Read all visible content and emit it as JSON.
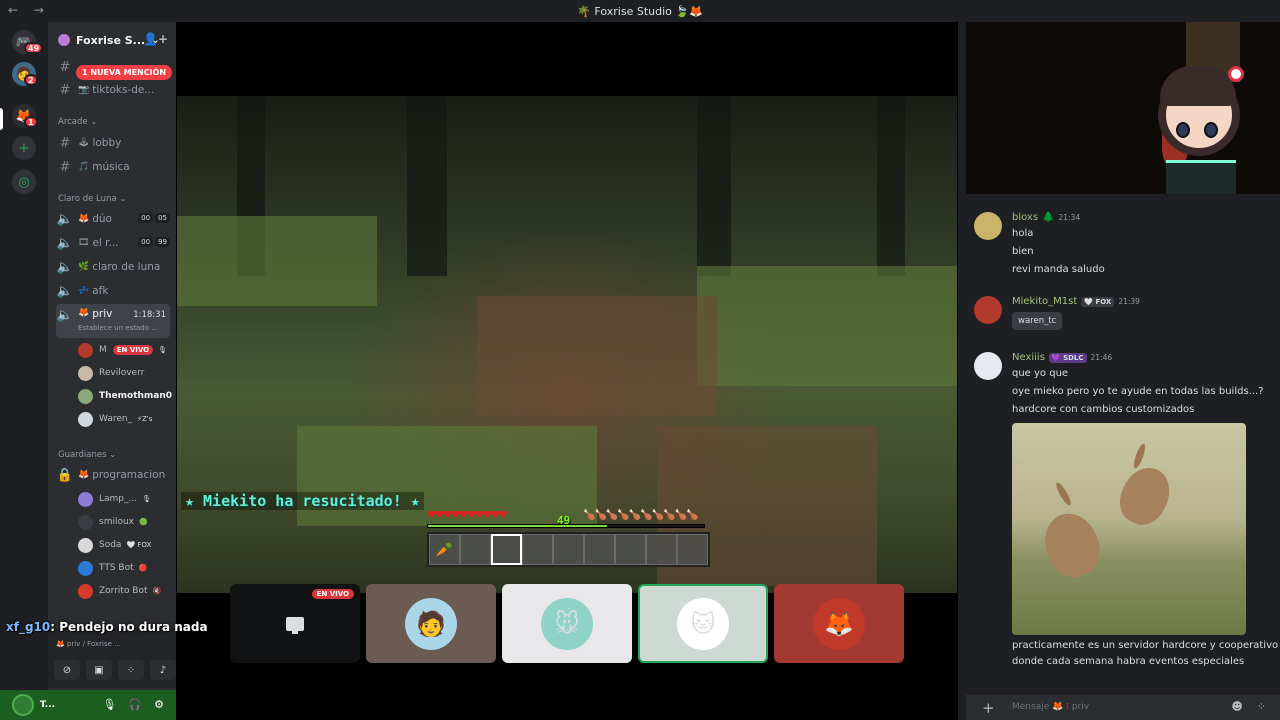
{
  "window": {
    "title": "🌴 Foxrise Studio 🍃🦊",
    "nav": "← →"
  },
  "rail": {
    "items": [
      {
        "name": "discord-home",
        "glyph": "🎮",
        "badge": "49"
      },
      {
        "name": "server-avatar",
        "glyph": "🧑",
        "badge": "2"
      },
      {
        "name": "foxrise-server",
        "glyph": "🦊",
        "badge": "1"
      },
      {
        "name": "add-server",
        "glyph": "+",
        "badge": ""
      },
      {
        "name": "discover",
        "glyph": "◎",
        "badge": ""
      }
    ]
  },
  "server": {
    "name": "Foxrise S...",
    "chevron": "⌄",
    "invite_icon": "👤+"
  },
  "mention_pill": "1 NUEVA MENCIÓN",
  "channels_top": [
    {
      "label": "tiktoks-de..."
    }
  ],
  "categories": {
    "arcade": "Arcade ⌄",
    "claro": "Claro de Luna ⌄",
    "guardianes": "Guardianes ⌄"
  },
  "arcade_channels": [
    {
      "emoji": "🕹",
      "label": "lobby"
    },
    {
      "emoji": "🎵",
      "label": "música"
    }
  ],
  "voice_channels": [
    {
      "emoji": "🦊",
      "label": "dúo",
      "c1": "00",
      "c2": "05"
    },
    {
      "emoji": "🎞",
      "label": "el r...",
      "c1": "00",
      "c2": "99"
    },
    {
      "emoji": "🌿",
      "label": "claro de luna",
      "c1": "",
      "c2": ""
    },
    {
      "emoji": "💤",
      "label": "afk",
      "c1": "",
      "c2": ""
    }
  ],
  "active_channel": {
    "emoji": "🦊",
    "label": "priv",
    "sub": "Establece un estado ...",
    "time": "1:18:31"
  },
  "voice_users": [
    {
      "name": "M",
      "live": "EN VIVO",
      "extra": "🎙",
      "color": "#b23a2c"
    },
    {
      "name": "Reviloverr",
      "live": "",
      "extra": "",
      "color": "#c7b9a8"
    },
    {
      "name": "Themothman0",
      "live": "",
      "extra": "",
      "color": "#8aa87a"
    },
    {
      "name": "Waren_",
      "live": "",
      "extra": "⚡Z's",
      "color": "#d0d8dd"
    }
  ],
  "guardianes_channel": {
    "label": "programacion"
  },
  "guardianes_users": [
    {
      "name": "Lamp_...",
      "extra": "🎙",
      "color": "#8e7bd6"
    },
    {
      "name": "smiloux",
      "extra": "🟢",
      "color": "#3a3c43"
    },
    {
      "name": "Soda",
      "extra": "🤍 FOX",
      "color": "#d9d9d9"
    },
    {
      "name": "TTS Bot",
      "extra": "🔴",
      "color": "#2b7bd6"
    },
    {
      "name": "Zorrito Bot",
      "extra": "🔇",
      "color": "#d63a2b"
    }
  ],
  "overlay_chat": {
    "nick": "xf_g10",
    "text": ": Pendejo no dura nada"
  },
  "voice_panel": {
    "line": "🦊 priv / Foxrise ..."
  },
  "user_panel": {
    "name": "T..."
  },
  "game": {
    "message": "★ Miekito ha resucitado! ★",
    "hearts": "♥♥♥♥♥♥♥♥♥♥",
    "food": "🍗🍗🍗🍗🍗🍗🍗🍗🍗🍗",
    "level": "49",
    "xp_fraction": 0.65,
    "hotbar": [
      "🥕",
      "",
      "",
      "",
      "",
      "",
      "",
      "",
      ""
    ],
    "selected_slot": 2
  },
  "tiles": [
    {
      "name": "screen-share",
      "live": "EN VIVO",
      "bg": "#111214",
      "glyph": ""
    },
    {
      "name": "participant-1",
      "live": "",
      "bg": "#6b5b52",
      "glyph": "🧑"
    },
    {
      "name": "participant-2",
      "live": "",
      "bg": "#e8e8ea",
      "glyph": "🐭"
    },
    {
      "name": "participant-3",
      "live": "",
      "bg": "#cfd9d4",
      "glyph": "🐱",
      "speaking": true
    },
    {
      "name": "participant-4",
      "live": "",
      "bg": "#a23a32",
      "glyph": "🦊"
    }
  ],
  "messages": [
    {
      "name": "bloxs",
      "tag": "🌲",
      "time": "21:34",
      "lines": [
        "hola",
        "bien",
        "revi manda saludo"
      ],
      "avatar": "#c9b46a"
    },
    {
      "name": "Miekito_M1st",
      "tag": "🤍 FOX",
      "time": "21:39",
      "reply": "waren_tc",
      "avatar": "#b23a2c"
    },
    {
      "name": "Nexiiis",
      "tag": "💜 SDLC",
      "time": "21:46",
      "lines": [
        "que yo que",
        "oye mieko pero yo te ayude en todas las builds...?",
        "hardcore con cambios customizados"
      ],
      "after": [
        "practicamente es un servidor hardcore y cooperativo",
        "donde cada semana habra eventos especiales"
      ],
      "avatar": "#e8e8f0"
    }
  ],
  "input": {
    "placeholder": "Mensaje 🦊 ⁝ priv"
  }
}
